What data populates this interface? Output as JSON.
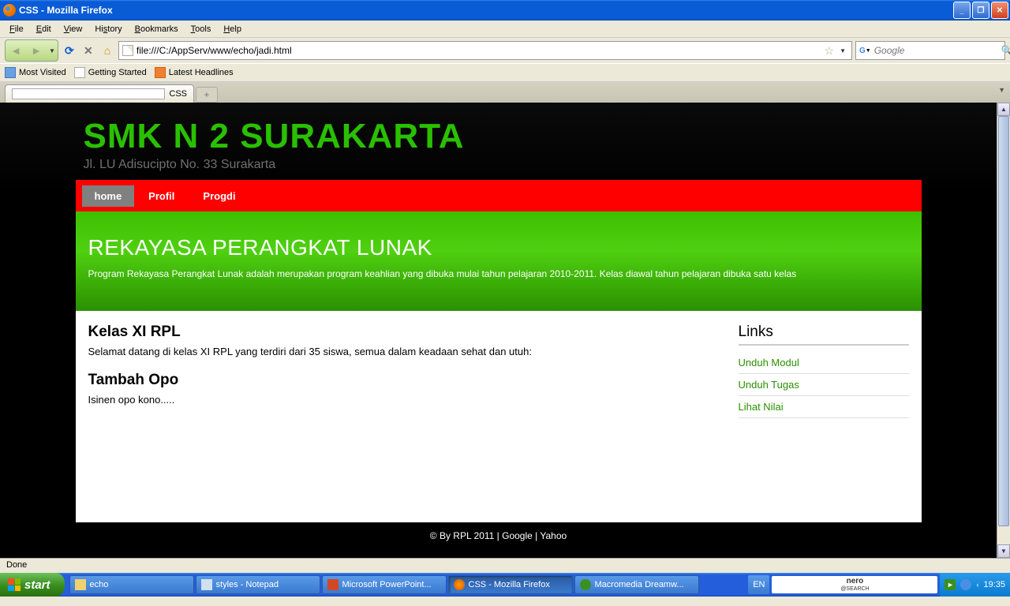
{
  "window": {
    "title": "CSS - Mozilla Firefox"
  },
  "menubar": {
    "file": "File",
    "edit": "Edit",
    "view": "View",
    "history": "History",
    "bookmarks": "Bookmarks",
    "tools": "Tools",
    "help": "Help"
  },
  "navbar": {
    "url": "file:///C:/AppServ/www/echo/jadi.html",
    "search_placeholder": "Google"
  },
  "bookmarks_toolbar": {
    "items": [
      "Most Visited",
      "Getting Started",
      "Latest Headlines"
    ]
  },
  "tabs": {
    "active": "CSS"
  },
  "site": {
    "title": "SMK N 2 SURAKARTA",
    "subtitle": "Jl. LU Adisucipto No. 33 Surakarta",
    "nav": {
      "home": "home",
      "profil": "Profil",
      "progdi": "Progdi"
    },
    "hero": {
      "title": "REKAYASA PERANGKAT LUNAK",
      "desc": "Program Rekayasa Perangkat Lunak adalah merupakan program keahlian yang dibuka mulai tahun pelajaran 2010-2011. Kelas diawal tahun pelajaran dibuka satu kelas"
    },
    "main": {
      "h1": "Kelas XI RPL",
      "p1": "Selamat datang di kelas XI RPL yang terdiri dari 35 siswa, semua dalam keadaan sehat dan utuh:",
      "h2": "Tambah Opo",
      "p2": "Isinen opo kono....."
    },
    "sidebar": {
      "title": "Links",
      "links": [
        "Unduh Modul",
        "Unduh Tugas",
        "Lihat Nilai"
      ]
    },
    "footer": "© By RPL 2011 | Google | Yahoo"
  },
  "statusbar": {
    "text": "Done"
  },
  "taskbar": {
    "start": "start",
    "tasks": [
      "echo",
      "styles - Notepad",
      "Microsoft PowerPoint...",
      "CSS - Mozilla Firefox",
      "Macromedia Dreamw..."
    ],
    "lang": "EN",
    "nero": "nero",
    "nero_sub": "@SEARCH",
    "clock": "19:35"
  }
}
